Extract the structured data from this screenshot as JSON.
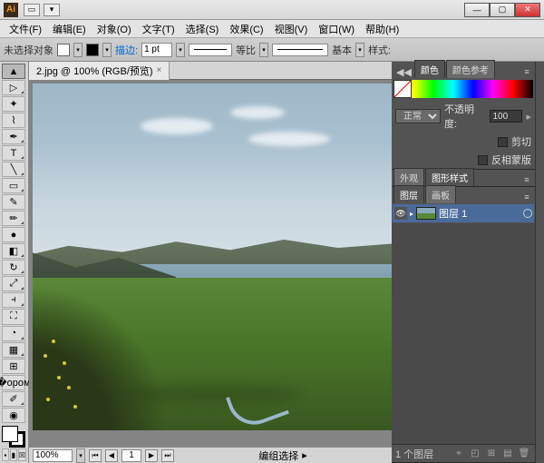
{
  "app": {
    "name": "Ai"
  },
  "menu": {
    "file": "文件(F)",
    "edit": "编辑(E)",
    "object": "对象(O)",
    "type": "文字(T)",
    "select": "选择(S)",
    "effect": "效果(C)",
    "view": "视图(V)",
    "window": "窗口(W)",
    "help": "帮助(H)"
  },
  "controlbar": {
    "no_selection": "未选择对象",
    "stroke_label": "描边:",
    "stroke_weight": "1 pt",
    "uniform": "等比",
    "basic": "基本",
    "style_label": "样式:"
  },
  "document": {
    "tab_title": "2.jpg @ 100% (RGB/预览)"
  },
  "status": {
    "zoom": "100%",
    "page": "1",
    "mode": "编组选择"
  },
  "panels": {
    "color_tab": "颜色",
    "color_guide_tab": "颜色参考",
    "blend_mode": "正常",
    "opacity_label": "不透明度:",
    "opacity_value": "100",
    "clip": "剪切",
    "invert_mask": "反相蒙版",
    "appearance_tab": "外观",
    "graphic_styles_tab": "图形样式",
    "layers_tab": "图层",
    "artboards_tab": "画板",
    "layer1_name": "图层 1",
    "layer_count": "1 个图层"
  }
}
